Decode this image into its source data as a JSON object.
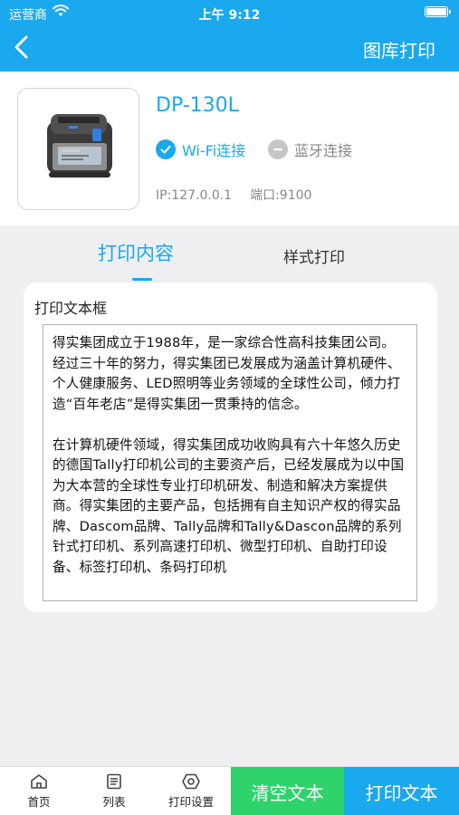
{
  "status_bar": {
    "carrier": "运营商",
    "time": "上午 9:12"
  },
  "nav": {
    "title": "图库打印",
    "back_icon": "chevron-left-icon"
  },
  "device": {
    "name": "DP-130L",
    "wifi_label": "Wi-Fi连接",
    "bluetooth_label": "蓝牙连接",
    "ip": "IP:127.0.0.1",
    "port": "端口:9100"
  },
  "tabs": [
    {
      "label": "打印内容",
      "active": true
    },
    {
      "label": "样式打印",
      "active": false
    }
  ],
  "text_panel": {
    "label": "打印文本框",
    "paragraphs": [
      "得实集团成立于1988年，是一家综合性高科技集团公司。经过三十年的努力，得实集团已发展成为涵盖计算机硬件、个人健康服务、LED照明等业务领域的全球性公司，倾力打造“百年老店”是得实集团一贯秉持的信念。",
      "在计算机硬件领域，得实集团成功收购具有六十年悠久历史的德国Tally打印机公司的主要资产后，已经发展成为以中国为大本营的全球性专业打印机研发、制造和解决方案提供商。得实集团的主要产品，包括拥有自主知识产权的得实品牌、Dascom品牌、Tally品牌和Tally&Dascon品牌的系列针式打印机、系列高速打印机、微型打印机、自助打印设备、标签打印机、条码打印机"
    ]
  },
  "bottom_bar": {
    "home_label": "首页",
    "list_label": "列表",
    "settings_label": "打印设置",
    "clear_button": "清空文本",
    "print_button": "打印文本"
  },
  "colors": {
    "accent": "#1aa8ee",
    "clear_green": "#2ed36b",
    "background": "#efeff1"
  }
}
